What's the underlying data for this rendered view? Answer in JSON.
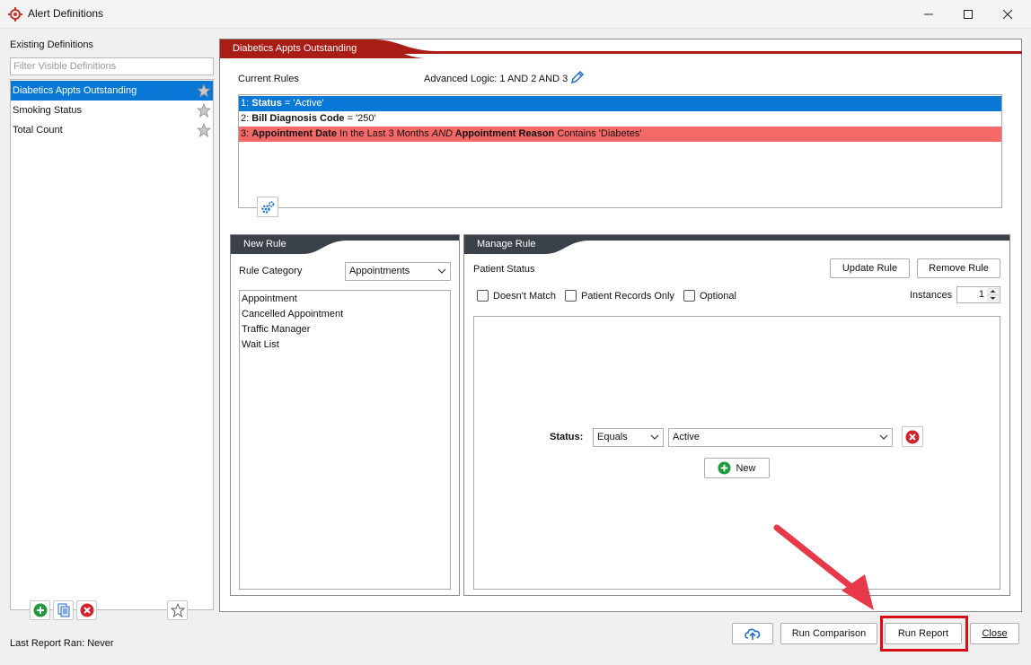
{
  "window": {
    "title": "Alert Definitions"
  },
  "left_panel": {
    "label": "Existing Definitions",
    "filter_placeholder": "Filter Visible Definitions",
    "definitions": [
      {
        "label": "Diabetics Appts Outstanding",
        "selected": true
      },
      {
        "label": "Smoking Status",
        "selected": false
      },
      {
        "label": "Total Count",
        "selected": false
      }
    ],
    "last_report_ran": "Last Report Ran: Never"
  },
  "main": {
    "tab_title": "Diabetics Appts Outstanding",
    "current_rules_label": "Current Rules",
    "advanced_logic": "Advanced Logic: 1 AND 2 AND 3",
    "rules": [
      {
        "num": "1: ",
        "field": "Status",
        "rest": " = 'Active'"
      },
      {
        "num": "2: ",
        "field": "Bill Diagnosis Code",
        "rest": " = '250'"
      },
      {
        "num": "3: ",
        "field": "Appointment Date",
        "mid": " In the Last 3 Months ",
        "conj": "AND",
        "field2": " Appointment Reason",
        "rest": " Contains 'Diabetes'"
      }
    ]
  },
  "new_rule": {
    "tab_title": "New Rule",
    "category_label": "Rule Category",
    "category_value": "Appointments",
    "categories": [
      "Appointment",
      "Cancelled Appointment",
      "Traffic Manager",
      "Wait List"
    ]
  },
  "manage_rule": {
    "tab_title": "Manage Rule",
    "rule_name": "Patient Status",
    "update_button": "Update Rule",
    "remove_button": "Remove Rule",
    "checkboxes": [
      "Doesn't Match",
      "Patient Records Only",
      "Optional"
    ],
    "instances_label": "Instances",
    "instances_value": "1",
    "condition": {
      "label": "Status:",
      "operator": "Equals",
      "value": "Active"
    },
    "new_button": "New"
  },
  "bottom": {
    "run_comparison": "Run Comparison",
    "run_report": "Run Report",
    "close": "Close"
  },
  "colors": {
    "selection_blue": "#0a78d7",
    "tab_header": "#a91d14",
    "tab_header_dark": "#3b4148",
    "rule_error_red": "#f76868",
    "annotation_red": "#d80d16",
    "add_green": "#1e9b3b"
  }
}
